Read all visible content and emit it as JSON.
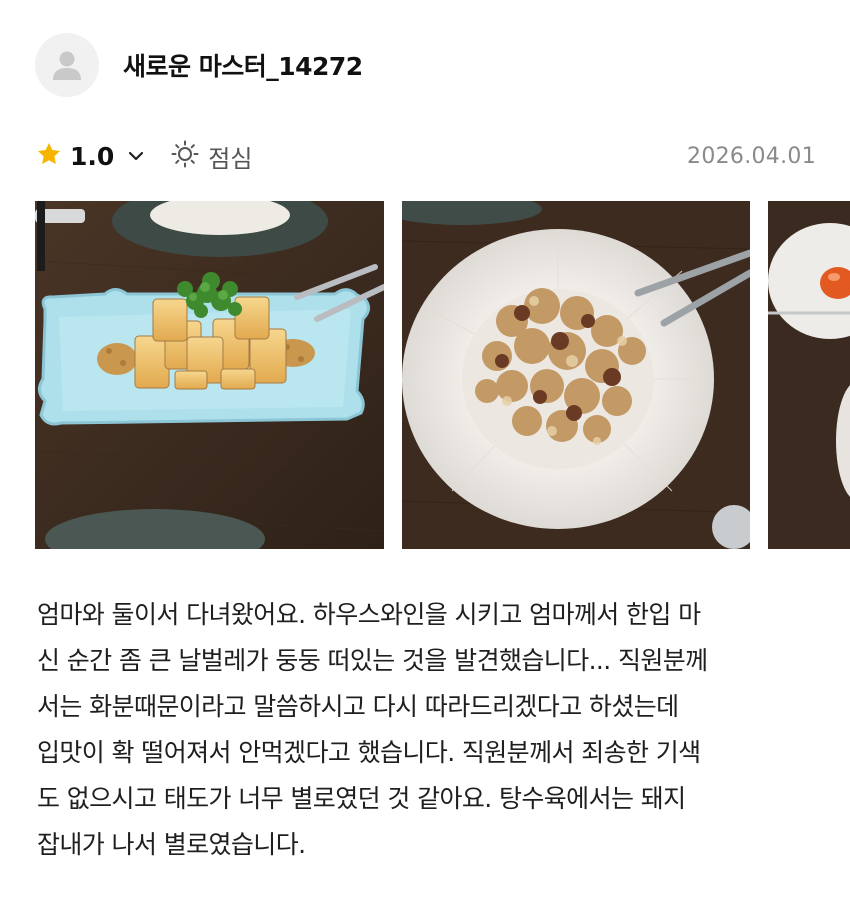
{
  "reviewer": {
    "name": "새로운 마스터_14272",
    "avatar_icon": "default-user-avatar-icon"
  },
  "review_meta": {
    "rating": "1.0",
    "rating_icon": "star-icon",
    "rating_toggle_icon": "chevron-down-icon",
    "meal_icon": "sun-icon",
    "meal_time": "점심",
    "date": "2026.04.01"
  },
  "photos": [
    {
      "subject": "fried tofu with cilantro on light blue plate"
    },
    {
      "subject": "sweet and sour pork on white plate"
    },
    {
      "subject": "partial dish"
    }
  ],
  "review_text": "엄마와 둘이서 다녀왔어요. 하우스와인을 시키고 엄마께서 한입 마\n신 순간 좀 큰 날벌레가 둥둥 떠있는 것을 발견했습니다... 직원분께\n서는 화분때문이라고 말씀하시고 다시 따라드리겠다고 하셨는데\n입맛이 확 떨어져서 안먹겠다고 했습니다. 직원분께서 죄송한 기색\n도 없으시고 태도가 너무 별로였던 것 같아요. 탕수육에서는 돼지\n잡내가 나서 별로였습니다.",
  "colors": {
    "star": "#f7b500",
    "table_wood": "#3a2a1e",
    "plate_blue": "#aee0ec"
  }
}
